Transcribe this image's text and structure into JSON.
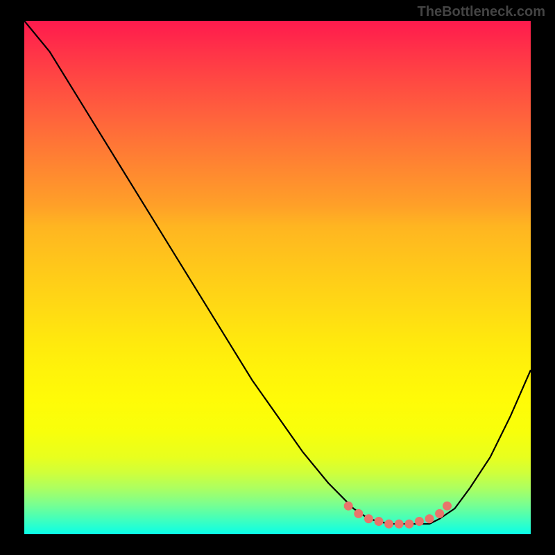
{
  "watermark": "TheBottleneck.com",
  "chart_data": {
    "type": "line",
    "title": "",
    "xlabel": "",
    "ylabel": "",
    "xlim": [
      0,
      100
    ],
    "ylim": [
      0,
      100
    ],
    "series": [
      {
        "name": "bottleneck-curve",
        "x": [
          0,
          5,
          10,
          15,
          20,
          25,
          30,
          35,
          40,
          45,
          50,
          55,
          60,
          65,
          68,
          72,
          76,
          80,
          82,
          85,
          88,
          92,
          96,
          100
        ],
        "y": [
          100,
          94,
          86,
          78,
          70,
          62,
          54,
          46,
          38,
          30,
          23,
          16,
          10,
          5,
          3,
          2,
          2,
          2,
          3,
          5,
          9,
          15,
          23,
          32
        ]
      }
    ],
    "markers": {
      "name": "optimal-range",
      "color": "#e8746b",
      "points": [
        {
          "x": 64,
          "y": 5.5
        },
        {
          "x": 66,
          "y": 4
        },
        {
          "x": 68,
          "y": 3
        },
        {
          "x": 70,
          "y": 2.5
        },
        {
          "x": 72,
          "y": 2
        },
        {
          "x": 74,
          "y": 2
        },
        {
          "x": 76,
          "y": 2
        },
        {
          "x": 78,
          "y": 2.5
        },
        {
          "x": 80,
          "y": 3
        },
        {
          "x": 82,
          "y": 4
        },
        {
          "x": 83.5,
          "y": 5.5
        }
      ]
    },
    "gradient_colors": {
      "top": "#ff1a4d",
      "upper_mid": "#ff8b2f",
      "mid": "#ffda14",
      "lower_mid": "#f8ff0b",
      "bottom": "#0affe8"
    }
  }
}
